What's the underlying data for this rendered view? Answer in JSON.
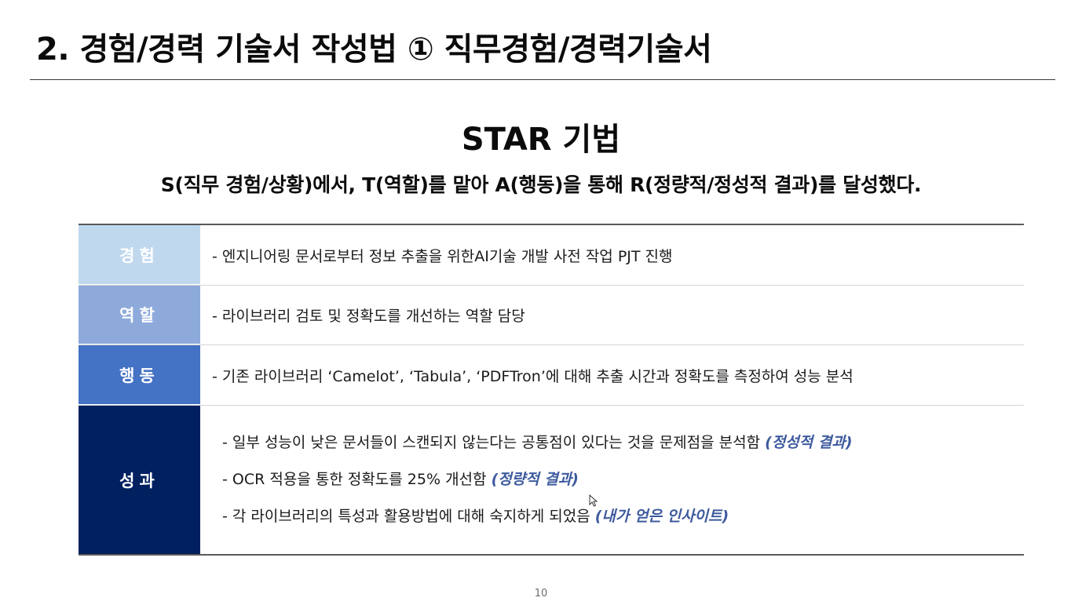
{
  "slide": {
    "title": "2. 경험/경력 기술서 작성법 ① 직무경험/경력기술서",
    "heading": "STAR 기법",
    "definition": "S(직무 경험/상황)에서, T(역할)를 맡아 A(행동)을 통해 R(정량적/정성적 결과)를 달성했다.",
    "page_number": "10"
  },
  "star_table": {
    "rows": [
      {
        "label": "경험",
        "color": "#c0d8ee",
        "content": "- 엔지니어링 문서로부터 정보 추출을 위한AI기술 개발 사전 작업 PJT 진행"
      },
      {
        "label": "역할",
        "color": "#8eaadb",
        "content": "- 라이브러리 검토 및 정확도를 개선하는 역할 담당"
      },
      {
        "label": "행동",
        "color": "#4472c4",
        "content": "- 기존 라이브러리 ‘Camelot’, ‘Tabula’, ‘PDFTron’에 대해 추출 시간과 정확도를 측정하여 성능 분석"
      },
      {
        "label": "성과",
        "color": "#002060",
        "lines": [
          {
            "text": "- 일부 성능이 낮은 문서들이 스캔되지 않는다는 공통점이 있다는 것을 문제점을 분석함",
            "tag": "(정성적 결과)"
          },
          {
            "text": "- OCR 적용을 통한 정확도를 25% 개선함",
            "tag": "(정량적 결과)"
          },
          {
            "text": "- 각 라이브러리의 특성과 활용방법에 대해 숙지하게 되었음",
            "tag": "(내가 얻은 인사이트)"
          }
        ]
      }
    ]
  },
  "cursor": {
    "icon": "mouse-pointer-icon"
  }
}
